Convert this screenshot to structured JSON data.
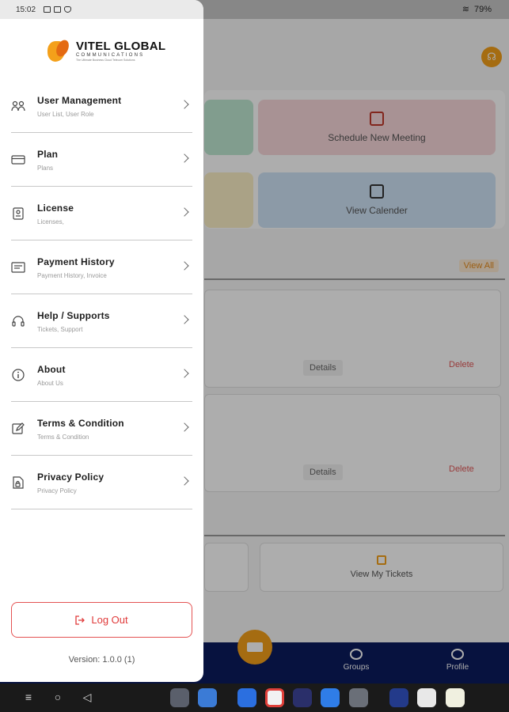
{
  "status_bar": {
    "time": "15:02",
    "battery": "79%"
  },
  "background": {
    "quick_actions": [
      "Schedule New Meeting",
      "View Calender"
    ],
    "view_all": "View All",
    "meeting_actions": {
      "details": "Details",
      "delete": "Delete"
    },
    "tickets_action": "View My Tickets",
    "nav": {
      "groups": "Groups",
      "profile": "Profile"
    }
  },
  "drawer": {
    "logo": {
      "name": "VITEL GLOBAL",
      "sub": "COMMUNICATIONS",
      "tagline": "The Ultimate Business Cloud Telecom Solutions"
    },
    "menu": [
      {
        "title": "User Management",
        "subtitle": "User List, User Role",
        "icon": "users-icon"
      },
      {
        "title": "Plan",
        "subtitle": "Plans",
        "icon": "card-icon"
      },
      {
        "title": "License",
        "subtitle": "Licenses,",
        "icon": "license-icon"
      },
      {
        "title": "Payment History",
        "subtitle": "Payment History, Invoice",
        "icon": "invoice-icon"
      },
      {
        "title": "Help / Supports",
        "subtitle": "Tickets, Support",
        "icon": "headset-icon"
      },
      {
        "title": "About",
        "subtitle": "About Us",
        "icon": "info-icon"
      },
      {
        "title": "Terms & Condition",
        "subtitle": "Terms & Condition",
        "icon": "edit-icon"
      },
      {
        "title": "Privacy Policy",
        "subtitle": "Privacy Policy",
        "icon": "document-lock-icon"
      }
    ],
    "logout_label": "Log Out",
    "version": "Version: 1.0.0 (1)"
  }
}
